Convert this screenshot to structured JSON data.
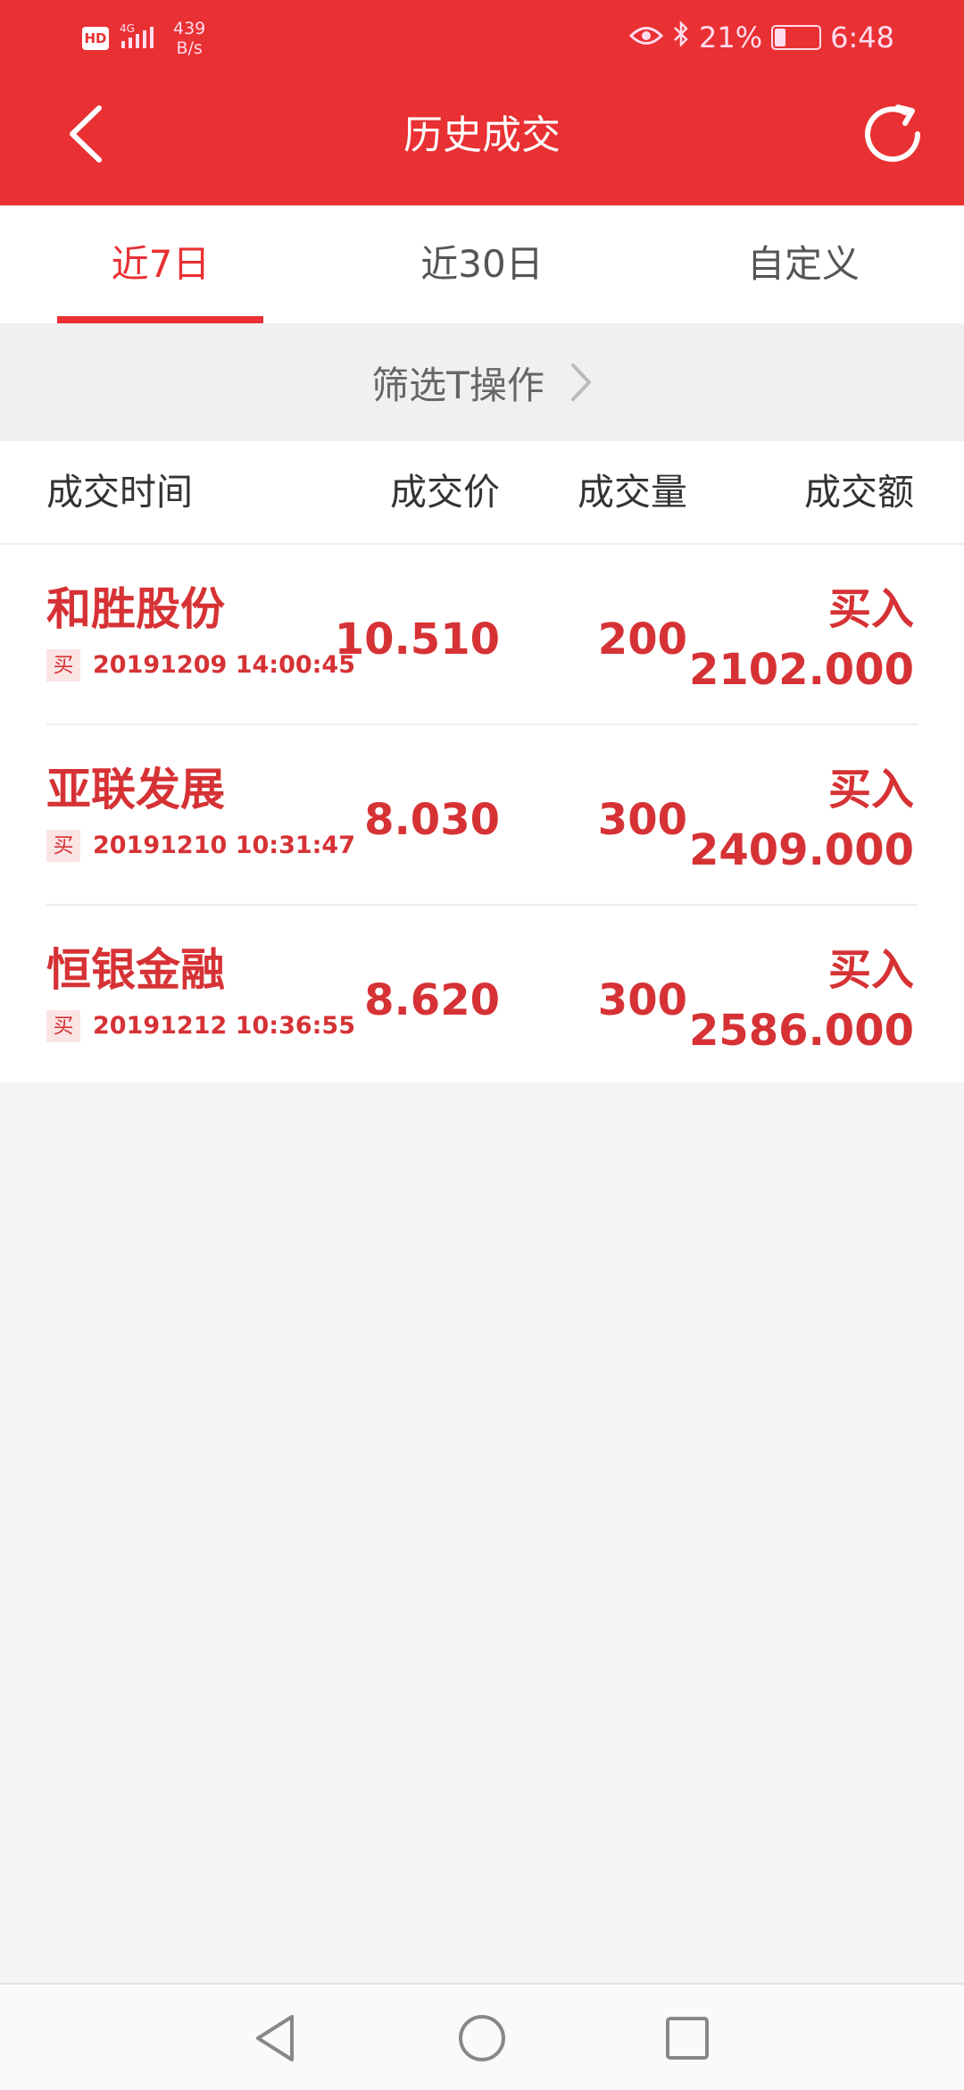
{
  "status_bar": {
    "hd": "HD",
    "network": "4G",
    "speed_value": "439",
    "speed_unit": "B/s",
    "battery": "21%",
    "time": "6:48"
  },
  "header": {
    "title": "历史成交"
  },
  "tabs": [
    {
      "label": "近7日",
      "active": true
    },
    {
      "label": "近30日",
      "active": false
    },
    {
      "label": "自定义",
      "active": false
    }
  ],
  "filter": {
    "label": "筛选T操作"
  },
  "columns": [
    "成交时间",
    "成交价",
    "成交量",
    "成交额"
  ],
  "trades": [
    {
      "name": "和胜股份",
      "tag": "买",
      "time": "20191209 14:00:45",
      "price": "10.510",
      "qty": "200",
      "side": "买入",
      "amount": "2102.000"
    },
    {
      "name": "亚联发展",
      "tag": "买",
      "time": "20191210 10:31:47",
      "price": "8.030",
      "qty": "300",
      "side": "买入",
      "amount": "2409.000"
    },
    {
      "name": "恒银金融",
      "tag": "买",
      "time": "20191212 10:36:55",
      "price": "8.620",
      "qty": "300",
      "side": "买入",
      "amount": "2586.000"
    }
  ],
  "colors": {
    "accent": "#e93033",
    "text_red": "#d63235",
    "background": "#f4f4f4"
  },
  "icons": {
    "back": "chevron-left-icon",
    "refresh": "refresh-icon",
    "filter_arrow": "chevron-right-icon",
    "nav_back": "triangle-back-icon",
    "nav_home": "circle-home-icon",
    "nav_recent": "square-recents-icon"
  }
}
